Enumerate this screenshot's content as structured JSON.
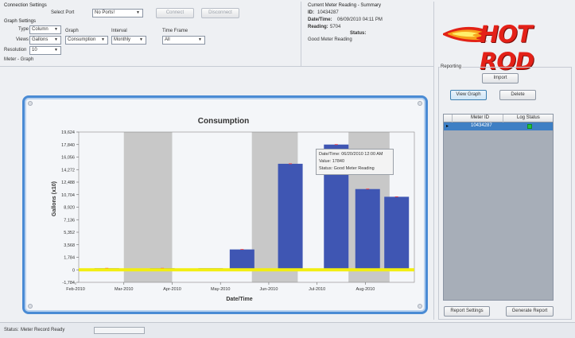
{
  "connection": {
    "title": "Connection Settings",
    "select_port_label": "Select Port",
    "port_value": "No Ports!",
    "connect_label": "Connect",
    "disconnect_label": "Disconnect"
  },
  "graph_settings": {
    "title": "Graph Settings",
    "type_label": "Type",
    "type_value": "Column",
    "views_label": "Views",
    "views_value": "Gallons",
    "resolution_label": "Resolution",
    "resolution_value": "10",
    "graph_label": "Graph",
    "graph_value": "Consumption",
    "interval_label": "Interval",
    "interval_value": "Monthly",
    "timeframe_label": "Time Frame",
    "timeframe_value": "All"
  },
  "meter_graph_title": "Meter - Graph",
  "summary": {
    "title": "Current Meter Reading - Summary",
    "id_label": "ID:",
    "id_value": "10434287",
    "datetime_label": "Date/Time:",
    "datetime_value": "06/09/2010 04:11 PM",
    "reading_label": "Reading:",
    "reading_value": "5704",
    "status_label": "Status:",
    "status_value": "Good Meter Reading"
  },
  "logo": {
    "text": "HOT ROD"
  },
  "reporting": {
    "title": "Reporting",
    "import_label": "Import",
    "view_graph_label": "View Graph",
    "delete_label": "Delete",
    "col_meter_id": "Meter ID",
    "col_log_status": "Log Status",
    "row_meter_id": "10434287",
    "row_log_status_color": "#22c33a",
    "report_settings_label": "Report Settings",
    "generate_report_label": "Generate Report"
  },
  "status_bar": {
    "label": "Status:",
    "value": "Meter Record Ready"
  },
  "tooltip": {
    "line1": "Date/Time: 06/20/2010 12:00 AM",
    "line2": "Value: 17840",
    "line3": "Status: Good Meter Reading"
  },
  "colors": {
    "bar": "#3f56b3",
    "shade": "#c8c8c8",
    "zero_line": "#f2ee10",
    "frame": "#4a8bd4"
  },
  "chart_data": {
    "type": "bar",
    "title": "Consumption",
    "xlabel": "Date/Time",
    "ylabel": "Gallons (x10)",
    "ylim": [
      -1784,
      19624
    ],
    "yticks": [
      "19,624",
      "17,840",
      "16,056",
      "14,272",
      "12,488",
      "10,704",
      "8,920",
      "7,136",
      "5,352",
      "3,568",
      "1,784",
      "0",
      "-1,784"
    ],
    "ytick_values": [
      19624,
      17840,
      16056,
      14272,
      12488,
      10704,
      8920,
      7136,
      5352,
      3568,
      1784,
      0,
      -1784
    ],
    "x_ticks": [
      "Feb-2010",
      "Mar-2010",
      "Apr-2010",
      "May-2010",
      "Jun-2010",
      "Jul-2010",
      "Aug-2010"
    ],
    "categories": [
      "Feb-2010",
      "Mar-2010",
      "Apr-2010",
      "May-2010",
      "Jun-2010",
      "Jul-2010",
      "Jul-2010b",
      "Aug-2010"
    ],
    "values": [
      100,
      100,
      0,
      2900,
      15100,
      17840,
      11500,
      10400
    ],
    "shaded_intervals": [
      "Mar-2010",
      "Jun-2010",
      "Aug-2010"
    ]
  }
}
